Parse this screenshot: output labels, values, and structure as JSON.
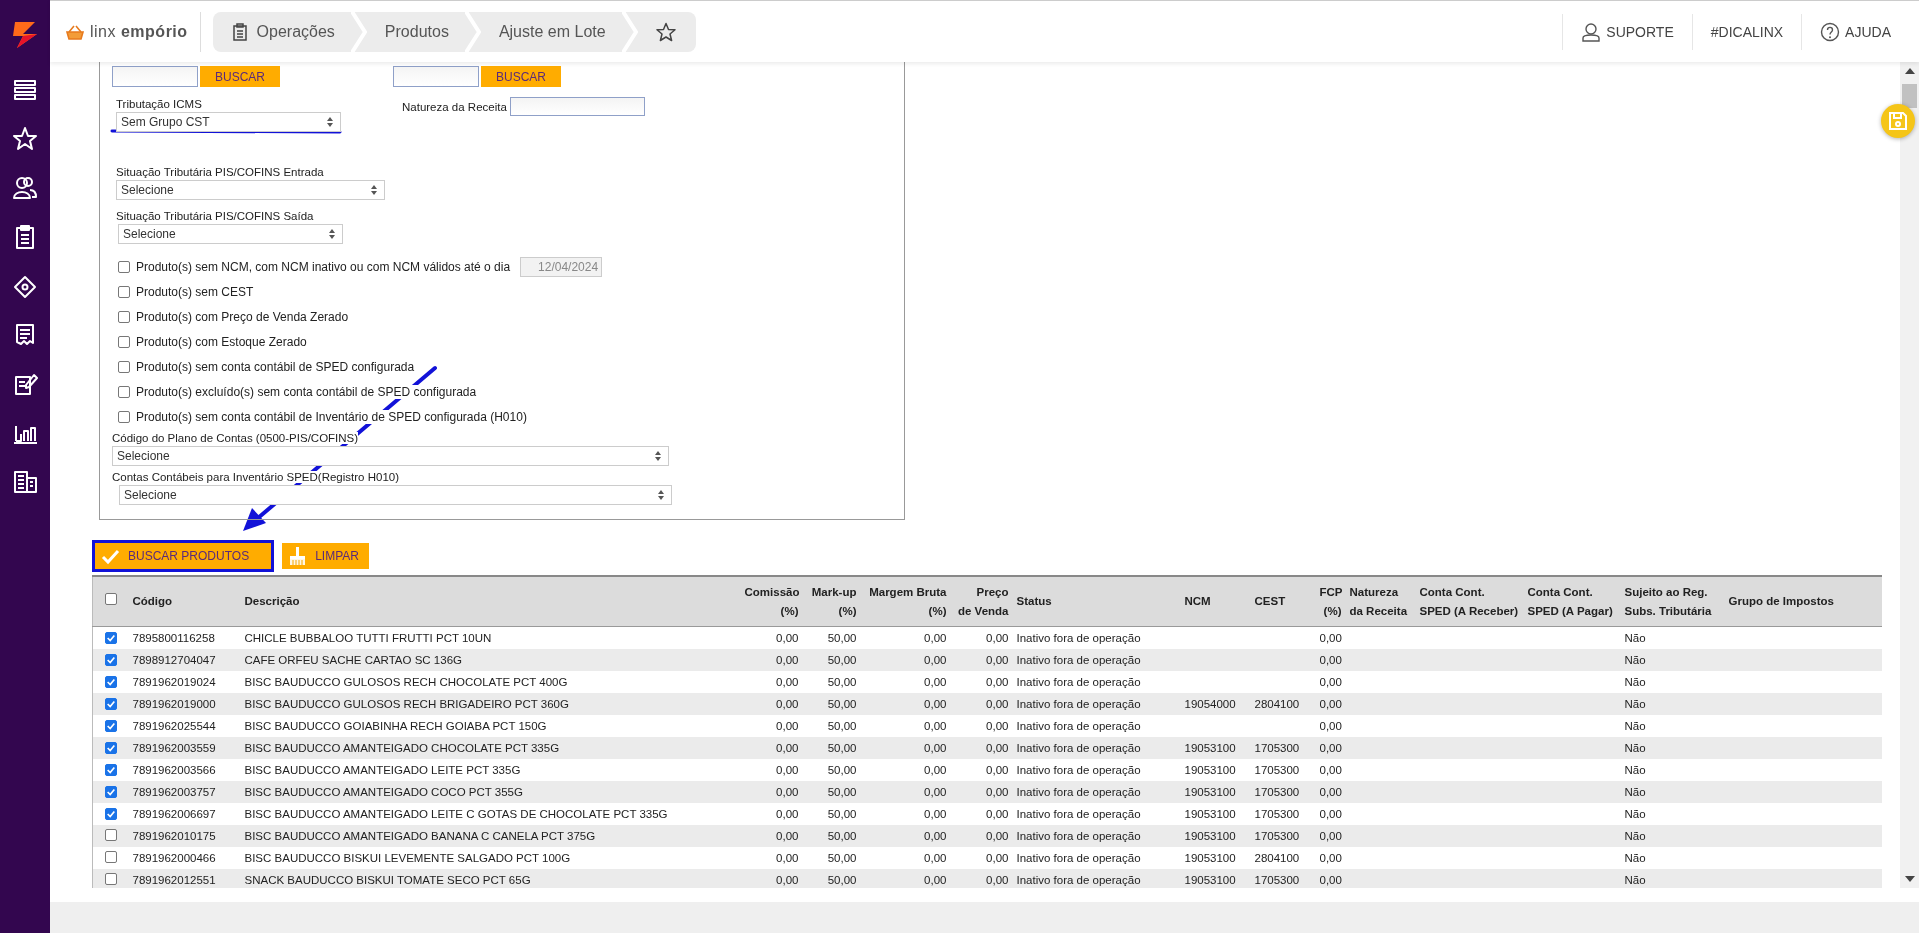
{
  "header": {
    "logo": "linx **empório**",
    "breadcrumb": [
      {
        "label": "Operações"
      },
      {
        "label": "Produtos"
      },
      {
        "label": "Ajuste em Lote"
      }
    ],
    "links": [
      {
        "kind": "user",
        "label": "SUPORTE"
      },
      {
        "kind": "text",
        "label": "#DICALINX"
      },
      {
        "kind": "help",
        "label": "AJUDA"
      }
    ]
  },
  "filters": {
    "ncm_search": "BUSCAR",
    "cest_search": "BUSCAR",
    "icms": {
      "label": "Tributação ICMS",
      "value": "Sem Grupo CST"
    },
    "natureza": {
      "label": "Natureza da Receita"
    },
    "pis_entrada": {
      "label": "Situação Tributária PIS/COFINS Entrada",
      "value": "Selecione"
    },
    "pis_saida": {
      "label": "Situação Tributária PIS/COFINS Saída",
      "value": "Selecione"
    },
    "options": [
      {
        "label": "Produto(s) sem NCM, com NCM inativo ou com NCM válidos até o dia",
        "checked": false,
        "date": "12/04/2024"
      },
      {
        "label": "Produto(s) sem CEST",
        "checked": false
      },
      {
        "label": "Produto(s) com Preço de Venda Zerado",
        "checked": false
      },
      {
        "label": "Produto(s) com Estoque Zerado",
        "checked": false
      },
      {
        "label": "Produto(s) sem conta contábil de SPED configurada",
        "checked": false
      },
      {
        "label": "Produto(s) excluído(s) sem conta contábil de SPED configurada",
        "checked": false
      },
      {
        "label": "Produto(s) sem conta contábil de Inventário de SPED configurada (H010)",
        "checked": false
      }
    ],
    "plano": {
      "label": "Código do Plano de Contas (0500-PIS/COFINS)",
      "value": "Selecione"
    },
    "contas": {
      "label": "Contas Contábeis para Inventário SPED(Registro H010)",
      "value": "Selecione"
    }
  },
  "actions": [
    {
      "kind": "search",
      "label": "BUSCAR PRODUTOS"
    },
    {
      "kind": "clear",
      "label": "LIMPAR"
    }
  ],
  "table": {
    "all_checked": false,
    "columns": [
      {
        "lines": [
          "Código"
        ]
      },
      {
        "lines": [
          "Descrição"
        ]
      },
      {
        "lines": [
          "Comissão",
          "(%)"
        ]
      },
      {
        "lines": [
          "Mark-up",
          "(%)"
        ]
      },
      {
        "lines": [
          "Margem Bruta",
          "(%)"
        ]
      },
      {
        "lines": [
          "Preço",
          "de Venda"
        ]
      },
      {
        "lines": [
          "Status"
        ]
      },
      {
        "lines": [
          "NCM"
        ]
      },
      {
        "lines": [
          "CEST"
        ]
      },
      {
        "lines": [
          "FCP",
          "(%)"
        ]
      },
      {
        "lines": [
          "Natureza",
          "da Receita"
        ]
      },
      {
        "lines": [
          "Conta Cont.",
          "SPED (A Receber)"
        ]
      },
      {
        "lines": [
          "Conta Cont.",
          "SPED (A Pagar)"
        ]
      },
      {
        "lines": [
          "Sujeito ao Reg.",
          "Subs. Tributária"
        ]
      },
      {
        "lines": [
          "Grupo de Impostos"
        ]
      }
    ],
    "rows": [
      {
        "checked": true,
        "cells": [
          "7895800116258",
          "CHICLE BUBBALOO TUTTI FRUTTI PCT 10UN",
          "0,00",
          "50,00",
          "0,00",
          "0,00",
          "Inativo fora de operação",
          null,
          null,
          "0,00",
          null,
          null,
          null,
          "Não",
          null
        ]
      },
      {
        "checked": true,
        "cells": [
          "7898912704047",
          "CAFE ORFEU SACHE CARTAO SC 136G",
          "0,00",
          "50,00",
          "0,00",
          "0,00",
          "Inativo fora de operação",
          null,
          null,
          "0,00",
          null,
          null,
          null,
          "Não",
          null
        ]
      },
      {
        "checked": true,
        "cells": [
          "7891962019024",
          "BISC BAUDUCCO GULOSOS RECH CHOCOLATE PCT 400G",
          "0,00",
          "50,00",
          "0,00",
          "0,00",
          "Inativo fora de operação",
          null,
          null,
          "0,00",
          null,
          null,
          null,
          "Não",
          null
        ]
      },
      {
        "checked": true,
        "cells": [
          "7891962019000",
          "BISC BAUDUCCO GULOSOS RECH BRIGADEIRO PCT 360G",
          "0,00",
          "50,00",
          "0,00",
          "0,00",
          "Inativo fora de operação",
          "19054000",
          "2804100",
          "0,00",
          null,
          null,
          null,
          "Não",
          null
        ]
      },
      {
        "checked": true,
        "cells": [
          "7891962025544",
          "BISC BAUDUCCO GOIABINHA RECH GOIABA PCT 150G",
          "0,00",
          "50,00",
          "0,00",
          "0,00",
          "Inativo fora de operação",
          null,
          null,
          "0,00",
          null,
          null,
          null,
          "Não",
          null
        ]
      },
      {
        "checked": true,
        "cells": [
          "7891962003559",
          "BISC BAUDUCCO AMANTEIGADO CHOCOLATE PCT 335G",
          "0,00",
          "50,00",
          "0,00",
          "0,00",
          "Inativo fora de operação",
          "19053100",
          "1705300",
          "0,00",
          null,
          null,
          null,
          "Não",
          null
        ]
      },
      {
        "checked": true,
        "cells": [
          "7891962003566",
          "BISC BAUDUCCO AMANTEIGADO LEITE PCT 335G",
          "0,00",
          "50,00",
          "0,00",
          "0,00",
          "Inativo fora de operação",
          "19053100",
          "1705300",
          "0,00",
          null,
          null,
          null,
          "Não",
          null
        ]
      },
      {
        "checked": true,
        "cells": [
          "7891962003757",
          "BISC BAUDUCCO AMANTEIGADO COCO PCT 355G",
          "0,00",
          "50,00",
          "0,00",
          "0,00",
          "Inativo fora de operação",
          "19053100",
          "1705300",
          "0,00",
          null,
          null,
          null,
          "Não",
          null
        ]
      },
      {
        "checked": true,
        "cells": [
          "7891962006697",
          "BISC BAUDUCCO AMANTEIGADO LEITE C GOTAS DE CHOCOLATE PCT 335G",
          "0,00",
          "50,00",
          "0,00",
          "0,00",
          "Inativo fora de operação",
          "19053100",
          "1705300",
          "0,00",
          null,
          null,
          null,
          "Não",
          null
        ]
      },
      {
        "checked": false,
        "cells": [
          "7891962010175",
          "BISC BAUDUCCO AMANTEIGADO BANANA C CANELA PCT 375G",
          "0,00",
          "50,00",
          "0,00",
          "0,00",
          "Inativo fora de operação",
          "19053100",
          "1705300",
          "0,00",
          null,
          null,
          null,
          "Não",
          null
        ]
      },
      {
        "checked": false,
        "cells": [
          "7891962000466",
          "BISC BAUDUCCO BISKUI LEVEMENTE SALGADO PCT 100G",
          "0,00",
          "50,00",
          "0,00",
          "0,00",
          "Inativo fora de operação",
          "19053100",
          "2804100",
          "0,00",
          null,
          null,
          null,
          "Não",
          null
        ]
      },
      {
        "checked": false,
        "cells": [
          "7891962012551",
          "SNACK BAUDUCCO BISKUI TOMATE SECO PCT 65G",
          "0,00",
          "50,00",
          "0,00",
          "0,00",
          "Inativo fora de operação",
          "19053100",
          "1705300",
          "0,00",
          null,
          null,
          null,
          "Não",
          null
        ]
      }
    ]
  }
}
